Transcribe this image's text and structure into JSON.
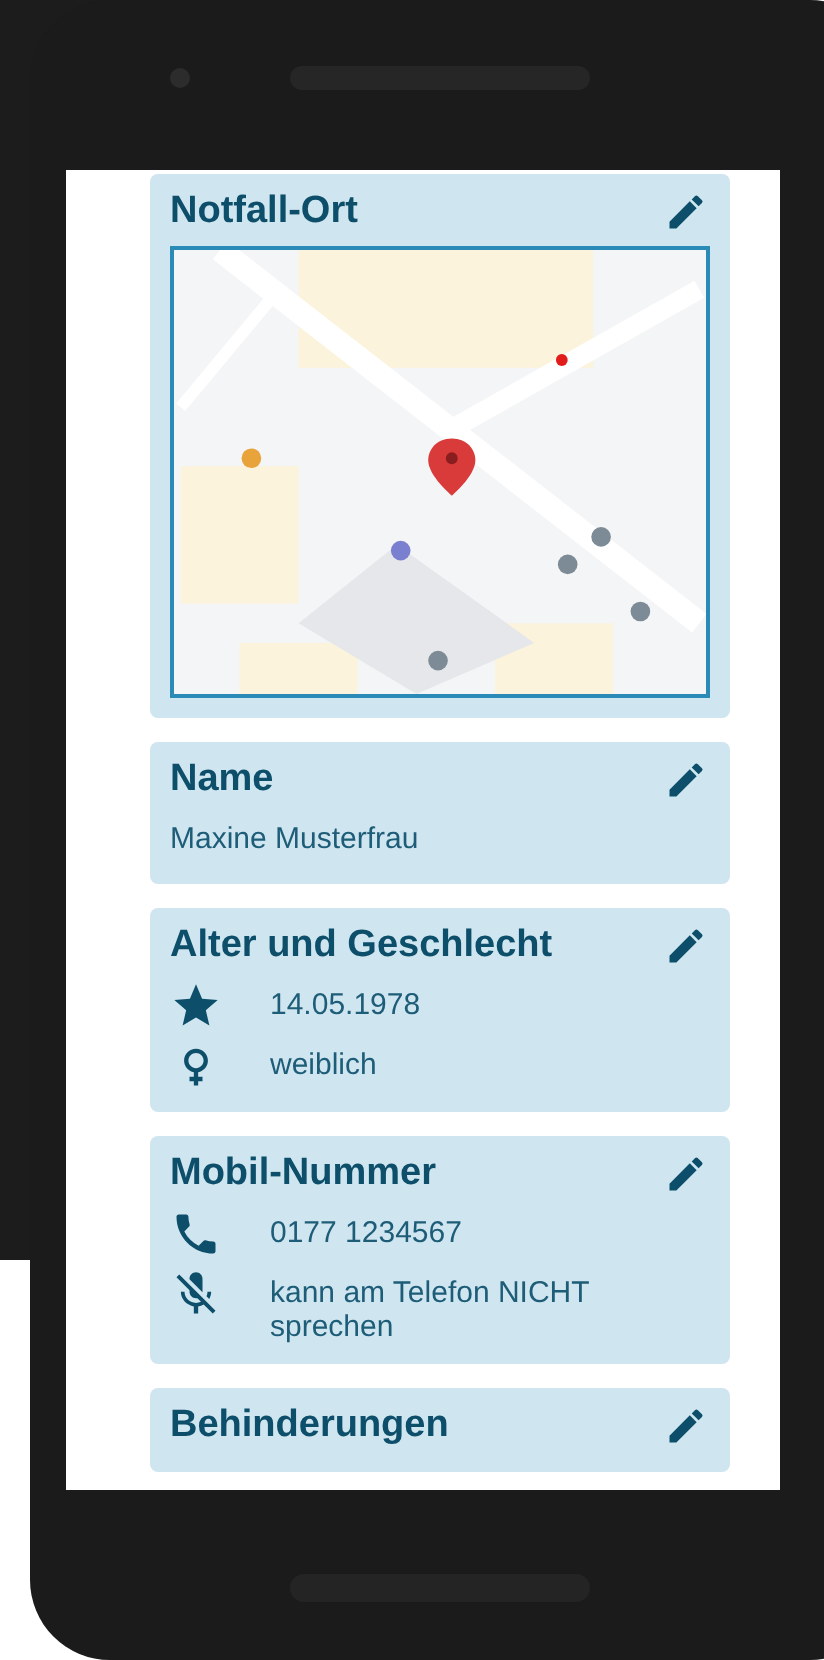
{
  "cards": [
    {
      "kind": "map",
      "title": "Notfall-Ort"
    },
    {
      "kind": "text",
      "title": "Name",
      "value": "Maxine Musterfrau"
    },
    {
      "kind": "rows",
      "title": "Alter und Geschlecht",
      "rows": [
        {
          "kind": "star",
          "text": "14.05.1978"
        },
        {
          "kind": "female",
          "text": "weiblich"
        }
      ]
    },
    {
      "kind": "rows",
      "title": "Mobil-Nummer",
      "rows": [
        {
          "kind": "phone",
          "text": "0177 1234567"
        },
        {
          "kind": "mic-off",
          "text": "kann am Telefon NICHT sprechen"
        }
      ]
    },
    {
      "kind": "empty",
      "title": "Behinderungen"
    }
  ]
}
